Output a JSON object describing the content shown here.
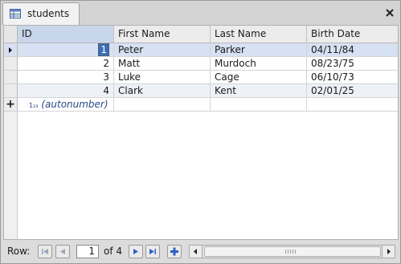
{
  "tab": {
    "label": "students",
    "icon": "table-icon"
  },
  "close_icon": "close-icon",
  "columns": [
    "ID",
    "First Name",
    "Last Name",
    "Birth Date"
  ],
  "rows": [
    {
      "id": "1",
      "first": "Peter",
      "last": "Parker",
      "birth": "04/11/84"
    },
    {
      "id": "2",
      "first": "Matt",
      "last": "Murdoch",
      "birth": "08/23/75"
    },
    {
      "id": "3",
      "first": "Luke",
      "last": "Cage",
      "birth": "06/10/73"
    },
    {
      "id": "4",
      "first": "Clark",
      "last": "Kent",
      "birth": "02/01/25"
    }
  ],
  "new_row": {
    "marker": "+",
    "autonumber_glyph": "1₂₃",
    "autonumber_label": "(autonumber)"
  },
  "nav": {
    "row_label": "Row:",
    "current": "1",
    "of_label": "of",
    "total": "4"
  },
  "colors": {
    "accent": "#3a6fb5",
    "selected_row": "#d6e1f3",
    "nav_arrow": "#2f62c4"
  }
}
